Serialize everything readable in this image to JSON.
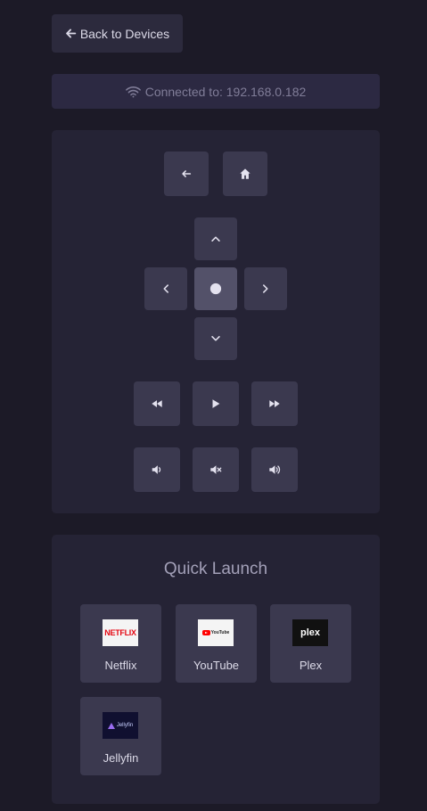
{
  "header": {
    "back_label": "Back to Devices"
  },
  "connection": {
    "text": "Connected to: 192.168.0.182"
  },
  "remote": {
    "buttons": {
      "back": "arrow-left-icon",
      "home": "home-icon",
      "up": "chevron-up-icon",
      "left": "chevron-left-icon",
      "ok": "circle-icon",
      "right": "chevron-right-icon",
      "down": "chevron-down-icon",
      "rewind": "rewind-icon",
      "play": "play-icon",
      "fast_forward": "fast-forward-icon",
      "volume_down": "volume-down-icon",
      "mute": "volume-mute-icon",
      "volume_up": "volume-up-icon"
    }
  },
  "quick_launch": {
    "title": "Quick Launch",
    "apps": [
      {
        "label": "Netflix",
        "logo_text": "NETFLIX"
      },
      {
        "label": "YouTube",
        "logo_text": "YouTube"
      },
      {
        "label": "Plex",
        "logo_text": "plex"
      },
      {
        "label": "Jellyfin",
        "logo_text": "Jellyfin"
      }
    ]
  },
  "colors": {
    "background": "#1c1a27",
    "panel": "#252335",
    "button": "#3b394f",
    "ok_button": "#535169",
    "connection_bar": "#2c2942"
  }
}
